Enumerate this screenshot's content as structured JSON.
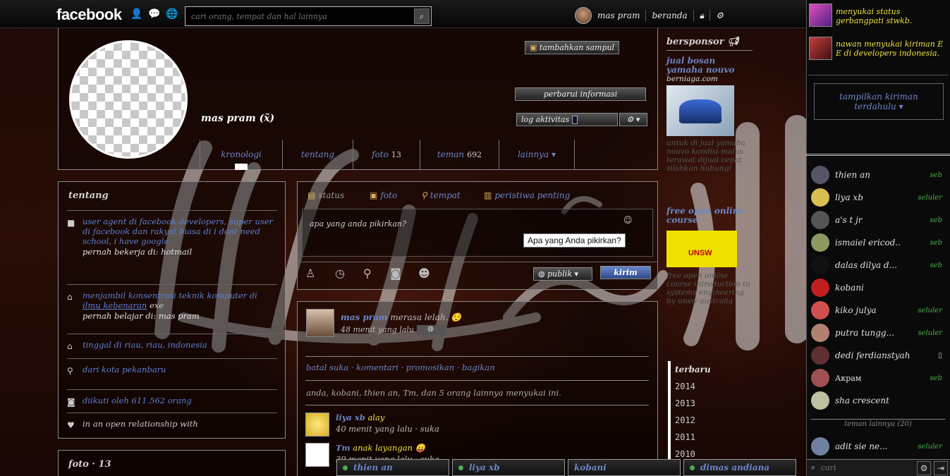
{
  "header": {
    "logo": "facebook",
    "search_placeholder": "cari orang, tempat dan hal lainnya",
    "user_name": "mas pram",
    "home_label": "beranda"
  },
  "profile": {
    "name": "mas pram (x̃)",
    "add_friend": "tambahkan sampul",
    "update_info": "perbarui informasi",
    "activity_log": "log aktivitas",
    "tabs": [
      {
        "label": "kronologi",
        "count": ""
      },
      {
        "label": "tentang",
        "count": ""
      },
      {
        "label": "foto",
        "count": "13"
      },
      {
        "label": "teman",
        "count": "692"
      },
      {
        "label": "lainnya ▾",
        "count": ""
      }
    ]
  },
  "about": {
    "title": "tentang",
    "items": [
      {
        "text": "user agent di facebook developers, super user di facebook dan rakyat biasa di i dont need school, i have google",
        "sub": "pernah bekerja di: hotmail"
      },
      {
        "text": "menjambil konsentrasi teknik komputer di ",
        "link": "ilmu kebenaran",
        "suffix": " exe",
        "sub": "pernah belajar di: mas pram"
      },
      {
        "text": "tinggal di riau, riau, indonesia",
        "sub": ""
      },
      {
        "text": "dari kota pekanbaru",
        "sub": ""
      },
      {
        "text": "diikuti oleh 611.562 orang",
        "sub": ""
      },
      {
        "text": "in an open relationship with",
        "sub": ""
      }
    ],
    "photos_title": "foto · 13"
  },
  "composer": {
    "tabs": [
      "status",
      "foto",
      "tempat",
      "peristiwa penting"
    ],
    "placeholder": "apa yang anda pikirkan?",
    "tooltip": "Apa yang Anda pikirkan?",
    "audience": "publik ▾",
    "post_button": "kirim"
  },
  "post": {
    "author": "mas pram",
    "feeling": "merasa lelah.",
    "time": "48 menit yang lalu",
    "actions": "batal suka · komentari · promosikan · bagikan",
    "likes_text": "anda, kobani, thien an, Tm, dan 5 orang lainnya menyukai ini.",
    "comments": [
      {
        "author": "liya xb",
        "text": "alay",
        "meta": "40 menit yang lalu · suka"
      },
      {
        "author": "Tm",
        "text": "anak layangan",
        "meta": "39 menit yang lalu · suka"
      }
    ]
  },
  "sponsored": {
    "title": "bersponsor",
    "ad1_title": "jual bosan yamaha nouvo",
    "ad1_site": "berniaga.com",
    "ad1_body": "untuk di jual yamaha nouvo kondisi mulus terawat dijual cepat silahkan hubungi",
    "ad2_title": "free open online course",
    "ad2_logo": "UNSW",
    "ad2_body": "free open online course introduction to systems engineering by unsw australia"
  },
  "years": [
    "terbaru",
    "2014",
    "2013",
    "2012",
    "2011",
    "2010"
  ],
  "chat_tabs": [
    "thien an",
    "liya xb",
    "kobani",
    "dimas andiana"
  ],
  "ticker": [
    {
      "text": "menyukai status gerbangpati stwkb."
    },
    {
      "text": "nawan menyukai kiriman E E di developers indonesia."
    }
  ],
  "show_earlier": "tampilkan kiriman terdahulu ▾",
  "chat": [
    {
      "name": "thien an",
      "status": "seb"
    },
    {
      "name": "liya xb",
      "status": "seluler"
    },
    {
      "name": "a's t jr",
      "status": "seb"
    },
    {
      "name": "ismaiel ericod..",
      "status": "seb"
    },
    {
      "name": "dalas dilya d...",
      "status": "seb"
    },
    {
      "name": "kobani",
      "status": ""
    },
    {
      "name": "kiko julya",
      "status": "seluler"
    },
    {
      "name": "putra tungg...",
      "status": "seluler"
    },
    {
      "name": "dedi ferdianstyah",
      "status": "▯"
    },
    {
      "name": "Акрам",
      "status": "seb"
    },
    {
      "name": "sha crescent",
      "status": ""
    },
    {
      "name": "adit sie ne...",
      "status": "seluler"
    }
  ],
  "more_friends": "teman lainnya (20)",
  "chat_search": "cari"
}
